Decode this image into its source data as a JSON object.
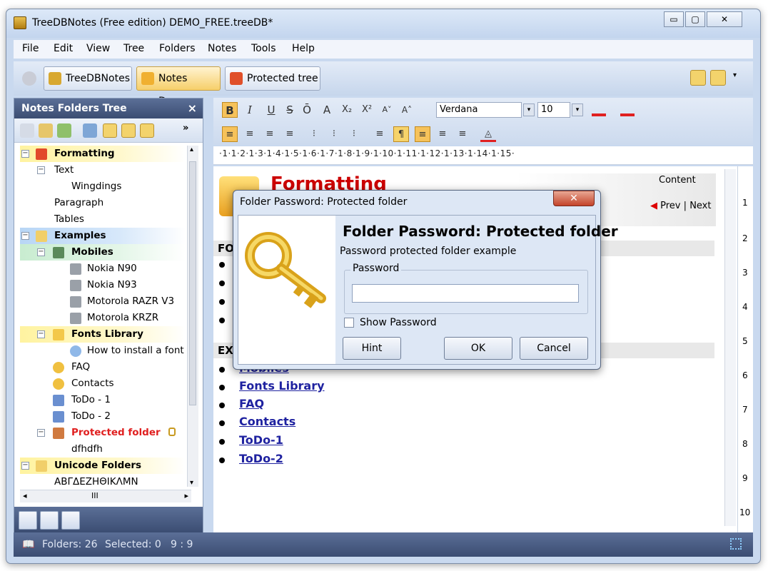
{
  "window": {
    "title": "TreeDBNotes (Free edition) DEMO_FREE.treeDB*"
  },
  "window_buttons": {
    "minimize": "▭",
    "maximize": "▢",
    "close": "✕"
  },
  "menu": [
    "File",
    "Edit",
    "View",
    "Tree",
    "Folders",
    "Notes",
    "Tools",
    "Help"
  ],
  "tabs": [
    {
      "label": "TreeDBNotes"
    },
    {
      "label": "Notes Demo"
    },
    {
      "label": "Protected tree"
    }
  ],
  "tree_panel": {
    "title": "Notes Folders Tree",
    "close": "×",
    "more": "»",
    "nodes": [
      {
        "label": "Formatting",
        "expander": "−",
        "bold": true
      },
      {
        "label": "Text",
        "expander": "−"
      },
      {
        "label": "Wingdings"
      },
      {
        "label": "Paragraph"
      },
      {
        "label": "Tables"
      },
      {
        "label": "Examples",
        "expander": "−",
        "bold": true
      },
      {
        "label": "Mobiles",
        "expander": "−",
        "bold": true
      },
      {
        "label": "Nokia N90"
      },
      {
        "label": "Nokia N93"
      },
      {
        "label": "Motorola RAZR V3"
      },
      {
        "label": "Motorola KRZR"
      },
      {
        "label": "Fonts Library",
        "expander": "−",
        "bold": true
      },
      {
        "label": "How to install a font"
      },
      {
        "label": "FAQ"
      },
      {
        "label": "Contacts"
      },
      {
        "label": "ToDo - 1"
      },
      {
        "label": "ToDo - 2"
      },
      {
        "label": "Protected folder",
        "expander": "−",
        "bold": true
      },
      {
        "label": "dfhdfh"
      },
      {
        "label": "Unicode Folders",
        "expander": "−",
        "bold": true
      },
      {
        "label": "ΑΒΓΔΕΖΗΘΙΚΛΜΝ"
      }
    ],
    "hscroll_thumb": "III",
    "scroll_left": "◂",
    "scroll_right": "▸",
    "scroll_up": "▴",
    "scroll_down": "▾"
  },
  "format_toolbar": {
    "font": "Verdana",
    "size": "10",
    "buttons": [
      "B",
      "I",
      "U",
      "S",
      "Ō",
      "A",
      "X₂",
      "X²",
      "A˅",
      "A˄"
    ]
  },
  "ruler": "·1·1·2·1·3·1·4·1·5·1·6·1·7·1·8·1·9·1·10·1·11·1·12·1·13·1·14·1·15·",
  "ruler_ticks": [
    "1",
    "2",
    "3",
    "4",
    "5",
    "6",
    "7",
    "8",
    "9",
    "10",
    "11",
    "12",
    "13",
    "14",
    "15"
  ],
  "vruler_ticks": [
    "1",
    "2",
    "3",
    "4",
    "5",
    "6",
    "7",
    "8",
    "9",
    "10"
  ],
  "document": {
    "title": "Formatting",
    "content_link": "Content",
    "prev": "Prev",
    "separator": "|",
    "next": "Next",
    "section1": "FO",
    "section2": "EX",
    "links": [
      "Mobiles",
      "Fonts Library",
      "FAQ",
      "Contacts",
      "ToDo-1",
      "ToDo-2"
    ]
  },
  "dialog": {
    "title": "Folder Password: Protected folder",
    "close": "✕",
    "heading": "Folder Password: Protected folder",
    "description": "Password protected folder example",
    "group_label": "Password",
    "password_value": "",
    "show_password": "Show Password",
    "hint": "Hint",
    "ok": "OK",
    "cancel": "Cancel"
  },
  "status": {
    "folders": "Folders: 26",
    "selected": "Selected: 0",
    "position": "9 : 9"
  },
  "colors": {
    "accent_red": "#cc0000",
    "link_blue": "#1f22a0",
    "panel_header": "#3b4d72"
  }
}
